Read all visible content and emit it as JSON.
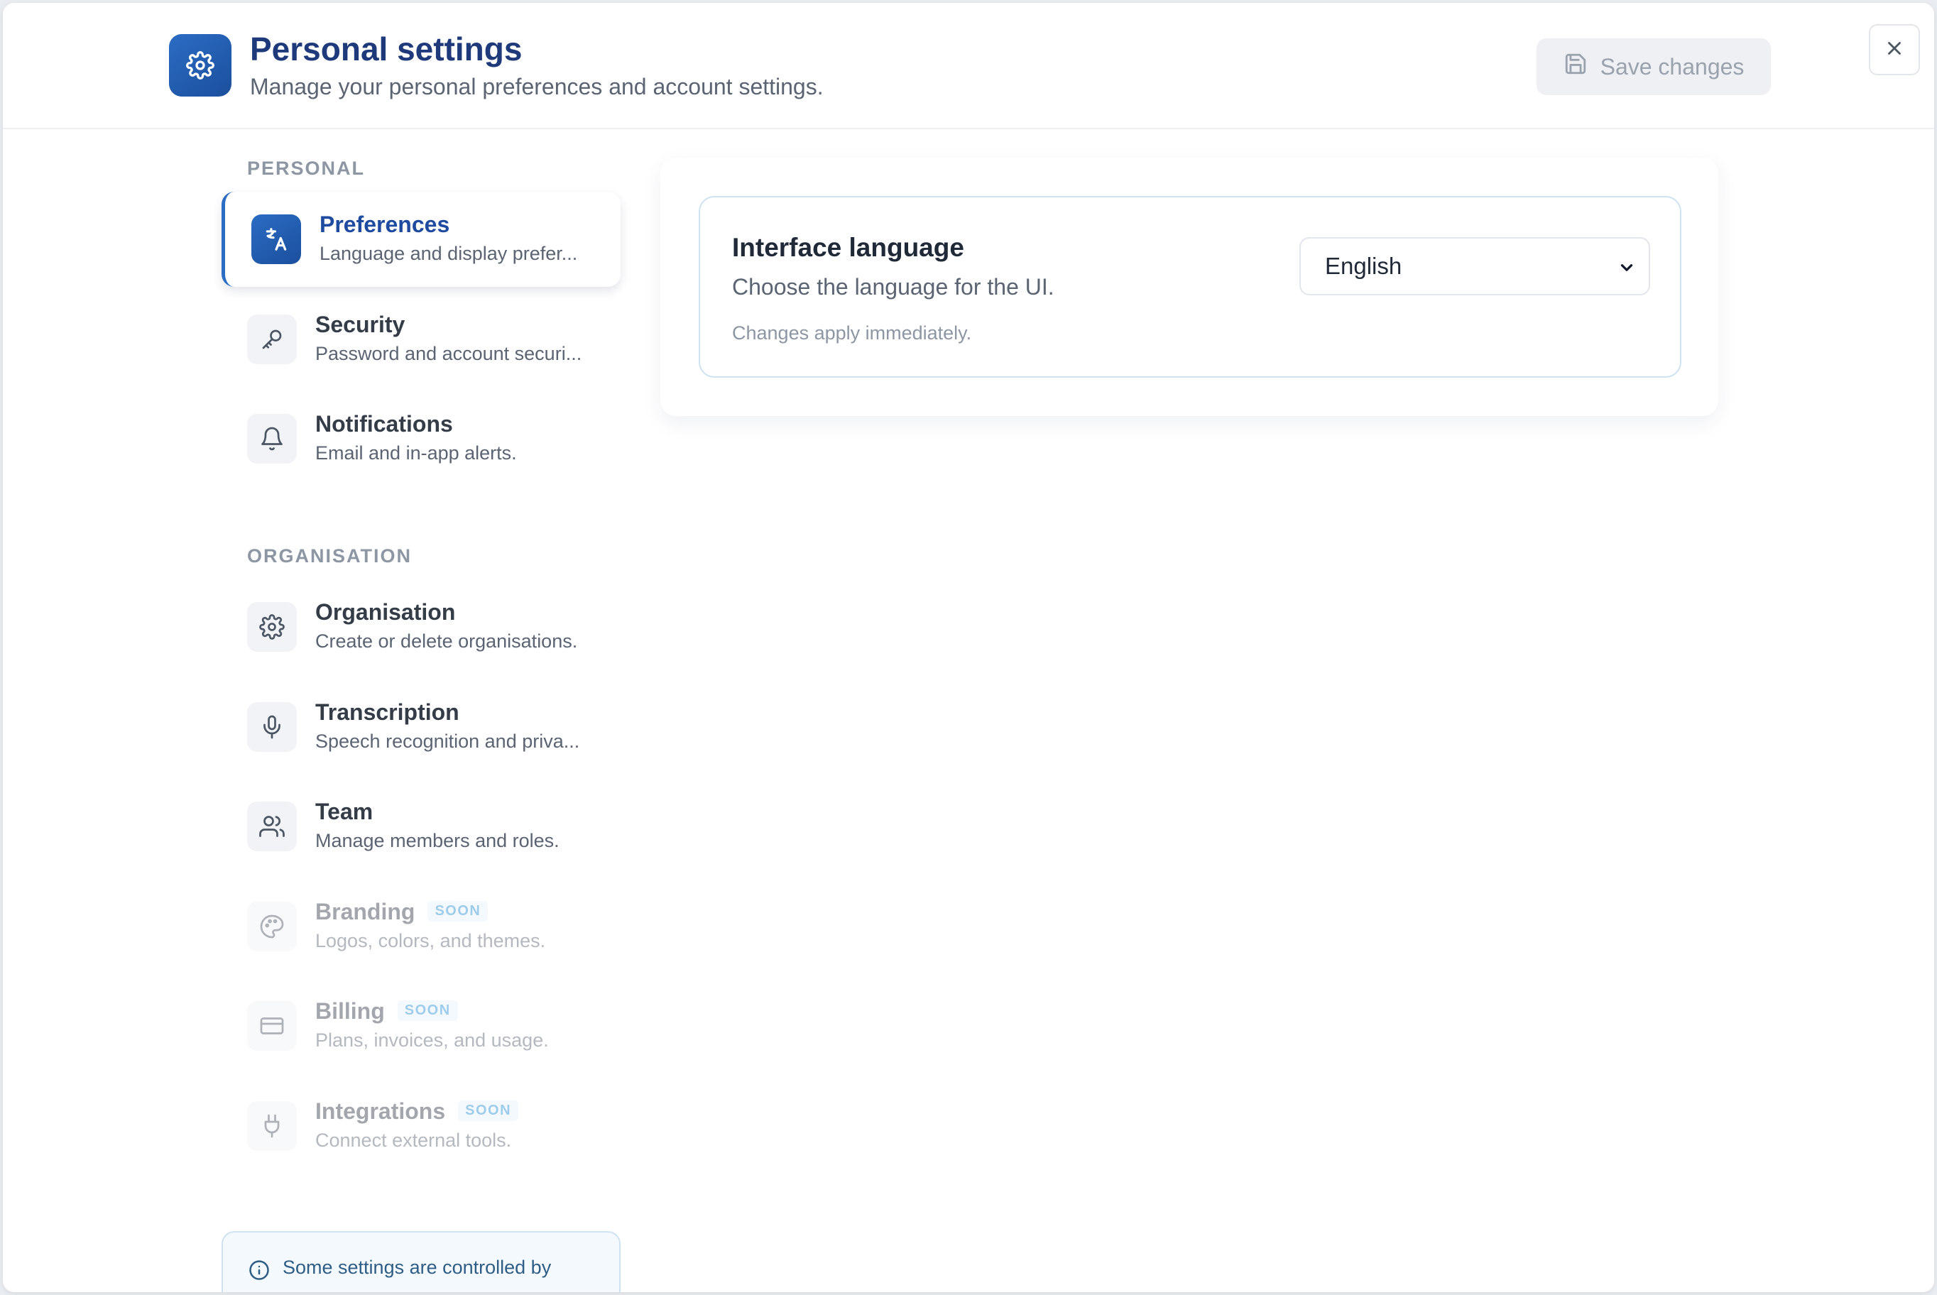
{
  "header": {
    "title": "Personal settings",
    "subtitle": "Manage your personal preferences and account settings.",
    "save_label": "Save changes"
  },
  "sidebar": {
    "personal_label": "PERSONAL",
    "organisation_label": "ORGANISATION",
    "personal_items": [
      {
        "title": "Preferences",
        "description": "Language and display prefer...",
        "icon": "translate-icon",
        "active": true
      },
      {
        "title": "Security",
        "description": "Password and account securi...",
        "icon": "key-icon"
      },
      {
        "title": "Notifications",
        "description": "Email and in-app alerts.",
        "icon": "bell-icon"
      }
    ],
    "organisation_items": [
      {
        "title": "Organisation",
        "description": "Create or delete organisations.",
        "icon": "gear-icon"
      },
      {
        "title": "Transcription",
        "description": "Speech recognition and priva...",
        "icon": "microphone-icon"
      },
      {
        "title": "Team",
        "description": "Manage members and roles.",
        "icon": "users-icon"
      },
      {
        "title": "Branding",
        "description": "Logos, colors, and themes.",
        "icon": "palette-icon",
        "badge": "SOON",
        "disabled": true
      },
      {
        "title": "Billing",
        "description": "Plans, invoices, and usage.",
        "icon": "credit-card-icon",
        "badge": "SOON",
        "disabled": true
      },
      {
        "title": "Integrations",
        "description": "Connect external tools.",
        "icon": "plug-icon",
        "badge": "SOON",
        "disabled": true
      }
    ],
    "info_text": "Some settings are controlled by"
  },
  "main": {
    "language_card": {
      "title": "Interface language",
      "description": "Choose the language for the UI.",
      "note": "Changes apply immediately.",
      "selected_language": "English"
    }
  },
  "colors": {
    "accent": "#1e4aa0",
    "accent_gradient_start": "#2b6cc4",
    "badge_text": "#2b8fd6",
    "card_border": "#cfe2f1"
  }
}
